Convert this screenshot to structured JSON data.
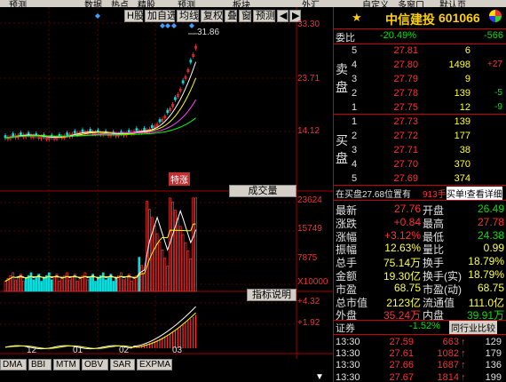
{
  "topbar": {
    "items": [
      "预测",
      "数据",
      "热点",
      "精股",
      "预测",
      "板块",
      "外汇",
      "自定义",
      "多窗口",
      "默认页"
    ]
  },
  "toolbar": {
    "buttons": [
      "H股",
      "加自选",
      "均线",
      "复权",
      "叠",
      "窗",
      "预测"
    ],
    "arrow_left": "◀",
    "arrow_right": "▶"
  },
  "price_axis": [
    "33.30",
    "23.71",
    "14.12"
  ],
  "high_marker": "31.86",
  "tag_label": "特涨",
  "volume_panel": {
    "label": "成交量",
    "axis": [
      "23624",
      "15749",
      "7875",
      "X10000"
    ]
  },
  "indicator_panel": {
    "label": "指标说明",
    "axis": [
      "+4.32",
      "+1.92"
    ]
  },
  "x_axis": [
    "12",
    "01",
    "02",
    "03"
  ],
  "bottom_tabs": [
    "DMA",
    "BBI",
    "MTM",
    "OBV",
    "SAR",
    "EXPMA"
  ],
  "stock": {
    "name": "中信建投",
    "code": "601066",
    "star": "★"
  },
  "commission": {
    "label": "委比",
    "ratio": "-20.49%",
    "diff": "-566"
  },
  "sell_label": "卖盘",
  "sell": [
    {
      "lvl": "5",
      "price": "27.81",
      "vol": "6",
      "chg": ""
    },
    {
      "lvl": "4",
      "price": "27.80",
      "vol": "1498",
      "chg": "+27"
    },
    {
      "lvl": "3",
      "price": "27.79",
      "vol": "9",
      "chg": ""
    },
    {
      "lvl": "2",
      "price": "27.78",
      "vol": "139",
      "chg": "-5"
    },
    {
      "lvl": "1",
      "price": "27.75",
      "vol": "12",
      "chg": "-9"
    }
  ],
  "buy_label": "买盘",
  "buy": [
    {
      "lvl": "1",
      "price": "27.73",
      "vol": "139"
    },
    {
      "lvl": "2",
      "price": "27.72",
      "vol": "177"
    },
    {
      "lvl": "3",
      "price": "27.71",
      "vol": "38"
    },
    {
      "lvl": "4",
      "price": "27.70",
      "vol": "370"
    },
    {
      "lvl": "5",
      "price": "27.69",
      "vol": "374"
    }
  ],
  "info_line": {
    "left": "在买盘27.68位置有",
    "mid": "913手",
    "right": "买单!查看详细"
  },
  "stats": [
    {
      "k1": "最新",
      "v1": "27.76",
      "k2": "开盘",
      "v2": "26.49"
    },
    {
      "k1": "涨跌",
      "v1": "+0.84",
      "k2": "最高",
      "v2": "27.78"
    },
    {
      "k1": "涨幅",
      "v1": "+3.12%",
      "k2": "最低",
      "v2": "24.38"
    },
    {
      "k1": "振幅",
      "v1": "12.63%",
      "k2": "量比",
      "v2": "0.99"
    },
    {
      "k1": "总手",
      "v1": "75.14万",
      "k2": "换手",
      "v2": "18.79%"
    },
    {
      "k1": "金额",
      "v1": "19.30亿",
      "k2": "换手(实)",
      "v2": "18.79%"
    },
    {
      "k1": "市盈",
      "v1": "68.75",
      "k2": "市盈(动)",
      "v2": "68.75"
    },
    {
      "k1": "总市值",
      "v1": "2123亿",
      "k2": "流通值",
      "v2": "111.0亿"
    },
    {
      "k1": "外盘",
      "v1": "35.24万",
      "k2": "内盘",
      "v2": "39.91万"
    }
  ],
  "sector": {
    "name": "证券",
    "pct": "-1.52%",
    "link": "同行业比较"
  },
  "ticks": [
    {
      "time": "13:30",
      "price": "27.59",
      "vol": "663",
      "dir": "↑",
      "n": "129"
    },
    {
      "time": "13:30",
      "price": "27.61",
      "vol": "1082",
      "dir": "↑",
      "n": "179"
    },
    {
      "time": "13:30",
      "price": "27.66",
      "vol": "1687",
      "dir": "↑",
      "n": "136"
    },
    {
      "time": "13:30",
      "price": "27.67",
      "vol": "1814",
      "dir": "↑",
      "n": "199"
    }
  ],
  "colors": {
    "up": "#ff3030",
    "down": "#00e0e0",
    "ma5": "#ffffff",
    "ma10": "#ffff00",
    "ma20": "#ff40ff",
    "ma60": "#00ff00",
    "grid": "#a00000"
  }
}
